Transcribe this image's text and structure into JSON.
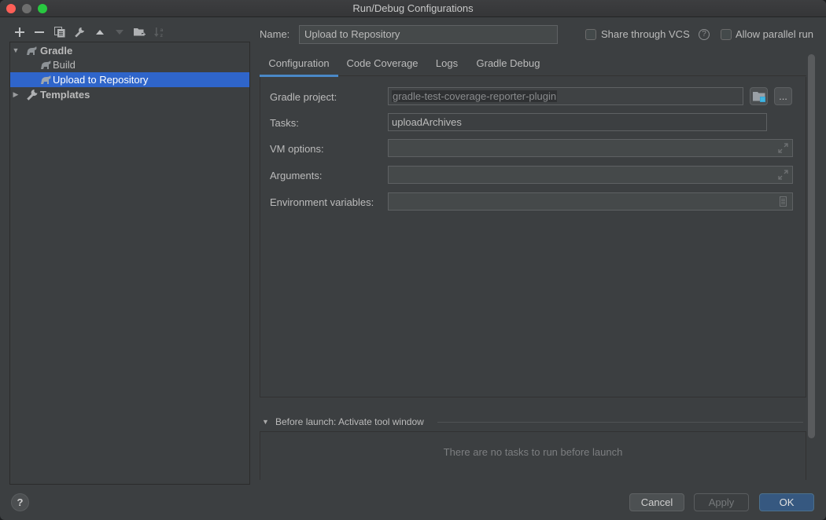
{
  "window": {
    "title": "Run/Debug Configurations"
  },
  "toolbar": {
    "buttons": [
      {
        "name": "add",
        "glyph": "+",
        "enabled": true
      },
      {
        "name": "remove",
        "glyph": "−",
        "enabled": true
      },
      {
        "name": "copy",
        "enabled": true
      },
      {
        "name": "edit-defaults",
        "enabled": true
      },
      {
        "name": "move-up",
        "enabled": true
      },
      {
        "name": "move-down",
        "enabled": false
      },
      {
        "name": "new-folder",
        "enabled": true
      },
      {
        "name": "sort",
        "enabled": false
      }
    ]
  },
  "tree": {
    "items": [
      {
        "label": "Gradle",
        "level": 0,
        "expanded": true,
        "icon": "gradle-elephant-icon",
        "bold": true
      },
      {
        "label": "Build",
        "level": 1,
        "icon": "gradle-elephant-icon"
      },
      {
        "label": "Upload to Repository",
        "level": 1,
        "icon": "gradle-elephant-icon",
        "selected": true
      },
      {
        "label": "Templates",
        "level": 0,
        "expanded": false,
        "icon": "wrench-icon",
        "bold": true
      }
    ]
  },
  "header": {
    "name_label": "Name:",
    "name_value": "Upload to Repository",
    "share_vcs_label": "Share through VCS",
    "share_vcs_checked": false,
    "allow_parallel_label": "Allow parallel run",
    "allow_parallel_checked": false
  },
  "tabs": [
    {
      "label": "Configuration",
      "active": true
    },
    {
      "label": "Code Coverage",
      "active": false
    },
    {
      "label": "Logs",
      "active": false
    },
    {
      "label": "Gradle Debug",
      "active": false
    }
  ],
  "form": {
    "gradle_project": {
      "label": "Gradle project:",
      "value": "gradle-test-coverage-reporter-plugin"
    },
    "tasks": {
      "label": "Tasks:",
      "value": "uploadArchives"
    },
    "vm_options": {
      "label": "VM options:",
      "value": ""
    },
    "arguments": {
      "label": "Arguments:",
      "value": ""
    },
    "env_vars": {
      "label": "Environment variables:",
      "value": ""
    },
    "browse_label": "..."
  },
  "before_launch": {
    "title": "Before launch: Activate tool window",
    "empty_text": "There are no tasks to run before launch"
  },
  "footer": {
    "help_label": "?",
    "cancel_label": "Cancel",
    "apply_label": "Apply",
    "ok_label": "OK"
  },
  "colors": {
    "selection": "#2f65ca",
    "accent": "#4a88c7",
    "ok_button": "#365880",
    "background": "#3c3f41"
  }
}
